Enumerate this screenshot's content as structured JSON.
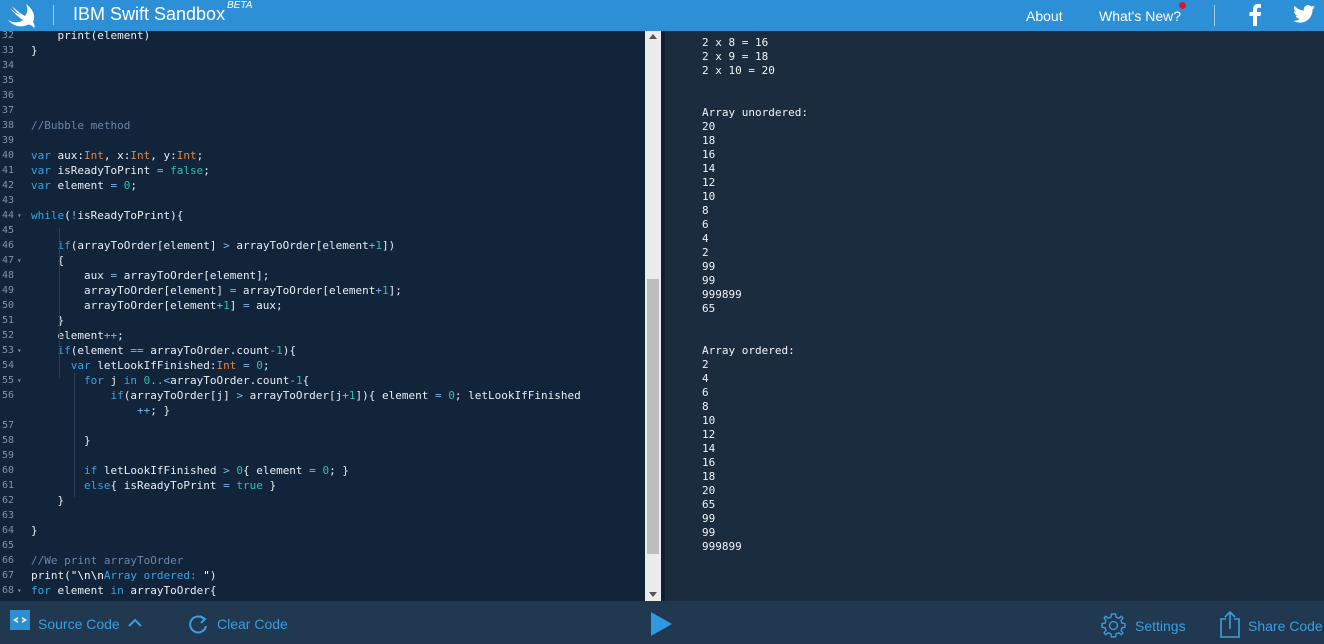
{
  "header": {
    "title": "IBM Swift Sandbox",
    "beta": "BETA",
    "nav": {
      "about": "About",
      "whats_new": "What's New?"
    }
  },
  "editor": {
    "lines": [
      {
        "n": "32",
        "fold": false,
        "html": "    <span>print(element)</span>"
      },
      {
        "n": "33",
        "fold": false,
        "html": "}"
      },
      {
        "n": "34",
        "fold": false,
        "html": ""
      },
      {
        "n": "35",
        "fold": false,
        "html": ""
      },
      {
        "n": "36",
        "fold": false,
        "html": ""
      },
      {
        "n": "37",
        "fold": false,
        "html": ""
      },
      {
        "n": "38",
        "fold": false,
        "html": "<span class=\"cm\">//Bubble method</span>"
      },
      {
        "n": "39",
        "fold": false,
        "html": ""
      },
      {
        "n": "40",
        "fold": false,
        "html": "<span class=\"kw\">var</span> aux:<span class=\"ty\">Int</span>, x:<span class=\"ty\">Int</span>, y:<span class=\"ty\">Int</span>;"
      },
      {
        "n": "41",
        "fold": false,
        "html": "<span class=\"kw\">var</span> isReadyToPrint <span class=\"op\">=</span> <span class=\"bool\">false</span>;"
      },
      {
        "n": "42",
        "fold": false,
        "html": "<span class=\"kw\">var</span> element <span class=\"op\">=</span> <span class=\"num\">0</span>;"
      },
      {
        "n": "43",
        "fold": false,
        "html": ""
      },
      {
        "n": "44",
        "fold": true,
        "html": "<span class=\"kw\">while</span>(<span class=\"op\">!</span>isReadyToPrint){"
      },
      {
        "n": "45",
        "fold": false,
        "html": ""
      },
      {
        "n": "46",
        "fold": false,
        "html": "    <span class=\"kw\">if</span>(arrayToOrder[element] <span class=\"op\">&gt;</span> arrayToOrder[element<span class=\"op\">+</span><span class=\"num\">1</span>])"
      },
      {
        "n": "47",
        "fold": true,
        "html": "    {"
      },
      {
        "n": "48",
        "fold": false,
        "html": "        aux <span class=\"op\">=</span> arrayToOrder[element];"
      },
      {
        "n": "49",
        "fold": false,
        "html": "        arrayToOrder[element] <span class=\"op\">=</span> arrayToOrder[element<span class=\"op\">+</span><span class=\"num\">1</span>];"
      },
      {
        "n": "50",
        "fold": false,
        "html": "        arrayToOrder[element<span class=\"op\">+</span><span class=\"num\">1</span>] <span class=\"op\">=</span> aux;"
      },
      {
        "n": "51",
        "fold": false,
        "html": "    }"
      },
      {
        "n": "52",
        "fold": false,
        "html": "    element<span class=\"op\">++</span>;"
      },
      {
        "n": "53",
        "fold": true,
        "html": "    <span class=\"kw\">if</span>(element <span class=\"op\">==</span> arrayToOrder.count<span class=\"op\">-</span><span class=\"num\">1</span>){"
      },
      {
        "n": "54",
        "fold": false,
        "html": "      <span class=\"kw\">var</span> letLookIfFinished:<span class=\"ty\">Int</span> <span class=\"op\">=</span> <span class=\"num\">0</span>;"
      },
      {
        "n": "55",
        "fold": true,
        "html": "        <span class=\"kw\">for</span> j <span class=\"kw\">in</span> <span class=\"num\">0</span><span class=\"op\">..&lt;</span>arrayToOrder.count<span class=\"op\">-</span><span class=\"num\">1</span>{"
      },
      {
        "n": "56",
        "fold": false,
        "html": "            <span class=\"kw\">if</span>(arrayToOrder[j] <span class=\"op\">&gt;</span> arrayToOrder[j<span class=\"op\">+</span><span class=\"num\">1</span>]){ element <span class=\"op\">=</span> <span class=\"num\">0</span>; letLookIfFinished"
      },
      {
        "n": "",
        "fold": false,
        "html": "                <span class=\"op\">++</span>; }"
      },
      {
        "n": "57",
        "fold": false,
        "html": ""
      },
      {
        "n": "58",
        "fold": false,
        "html": "        }"
      },
      {
        "n": "59",
        "fold": false,
        "html": ""
      },
      {
        "n": "60",
        "fold": false,
        "html": "        <span class=\"kw\">if</span> letLookIfFinished <span class=\"op\">&gt;</span> <span class=\"num\">0</span>{ element <span class=\"op\">=</span> <span class=\"num\">0</span>; }"
      },
      {
        "n": "61",
        "fold": false,
        "html": "        <span class=\"kw\">else</span>{ isReadyToPrint <span class=\"op\">=</span> <span class=\"bool\">true</span> }"
      },
      {
        "n": "62",
        "fold": false,
        "html": "    }"
      },
      {
        "n": "63",
        "fold": false,
        "html": ""
      },
      {
        "n": "64",
        "fold": false,
        "html": "}"
      },
      {
        "n": "65",
        "fold": false,
        "html": ""
      },
      {
        "n": "66",
        "fold": false,
        "html": "<span class=\"cm\">//We print arrayToOrder</span>"
      },
      {
        "n": "67",
        "fold": false,
        "html": "print(<span class=\"str\">\"\\n\\n</span><span class=\"kw\">Array ordered: </span><span class=\"str\">\"</span>)"
      },
      {
        "n": "68",
        "fold": true,
        "html": "<span class=\"kw\">for</span> element <span class=\"kw\">in</span> arrayToOrder{"
      }
    ]
  },
  "output": {
    "lines": [
      "2 x 8 = 16",
      "2 x 9 = 18",
      "2 x 10 = 20",
      "",
      "",
      "Array unordered:",
      "20",
      "18",
      "16",
      "14",
      "12",
      "10",
      "8",
      "6",
      "4",
      "2",
      "99",
      "99",
      "999899",
      "65",
      "",
      "",
      "Array ordered:",
      "2",
      "4",
      "6",
      "8",
      "10",
      "12",
      "14",
      "16",
      "18",
      "20",
      "65",
      "99",
      "99",
      "999899"
    ]
  },
  "footer": {
    "source_code": "Source Code",
    "clear_code": "Clear Code",
    "settings": "Settings",
    "share_code": "Share Code"
  },
  "colors": {
    "header": "#2d8fd5",
    "editor_bg": "#11243a",
    "output_bg": "#1c2c3f",
    "footer_bg": "#203850",
    "accent": "#3a9fe0"
  }
}
